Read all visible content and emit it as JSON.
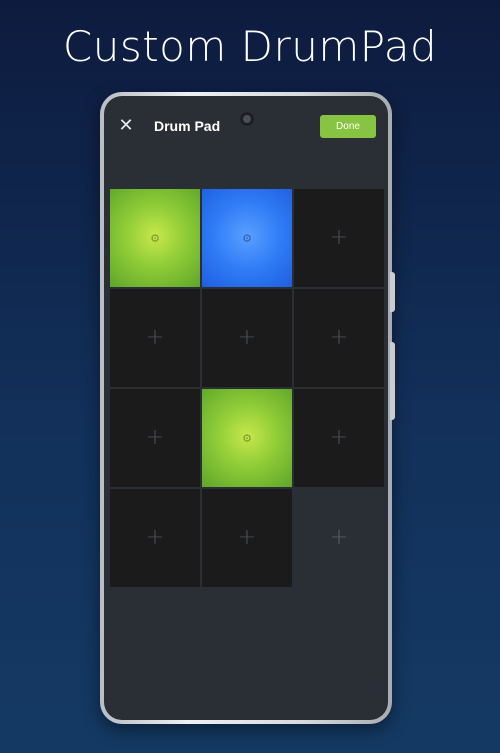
{
  "promo": {
    "title": "Custom DrumPad"
  },
  "header": {
    "close_glyph": "✕",
    "title": "Drum Pad",
    "done_label": "Done"
  },
  "icons": {
    "close": "close-icon",
    "gear": "gear-icon",
    "add": "plus-icon"
  },
  "colors": {
    "accent_green": "#86c441",
    "pad_green": "#8fcc37",
    "pad_blue": "#2f7cf6",
    "pad_empty": "#1b1b1c",
    "screen_bg": "#2a2e35"
  },
  "pads": [
    {
      "state": "green"
    },
    {
      "state": "blue"
    },
    {
      "state": "empty"
    },
    {
      "state": "empty"
    },
    {
      "state": "empty"
    },
    {
      "state": "empty"
    },
    {
      "state": "empty"
    },
    {
      "state": "green"
    },
    {
      "state": "empty"
    },
    {
      "state": "empty"
    },
    {
      "state": "empty"
    },
    {
      "state": "empty-light"
    }
  ]
}
